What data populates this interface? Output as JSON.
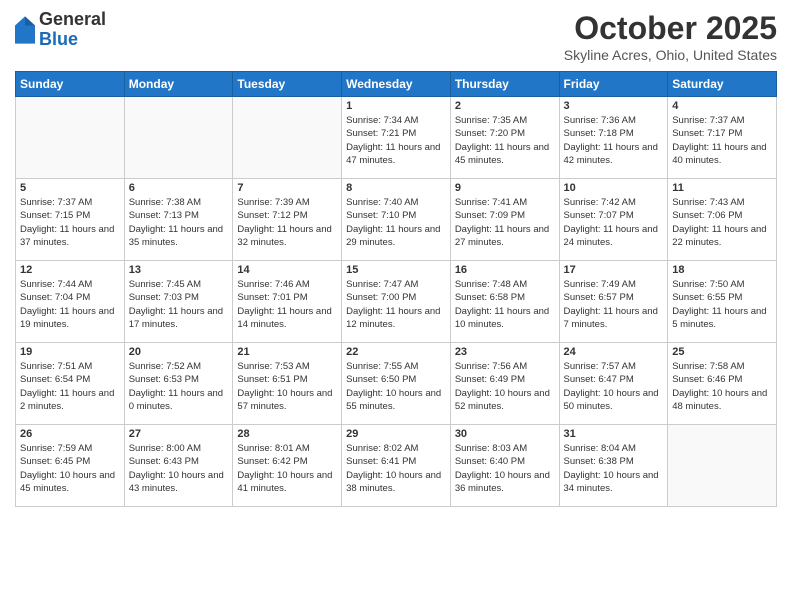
{
  "header": {
    "logo_general": "General",
    "logo_blue": "Blue",
    "title": "October 2025",
    "subtitle": "Skyline Acres, Ohio, United States"
  },
  "days_of_week": [
    "Sunday",
    "Monday",
    "Tuesday",
    "Wednesday",
    "Thursday",
    "Friday",
    "Saturday"
  ],
  "weeks": [
    [
      {
        "day": "",
        "info": ""
      },
      {
        "day": "",
        "info": ""
      },
      {
        "day": "",
        "info": ""
      },
      {
        "day": "1",
        "info": "Sunrise: 7:34 AM\nSunset: 7:21 PM\nDaylight: 11 hours\nand 47 minutes."
      },
      {
        "day": "2",
        "info": "Sunrise: 7:35 AM\nSunset: 7:20 PM\nDaylight: 11 hours\nand 45 minutes."
      },
      {
        "day": "3",
        "info": "Sunrise: 7:36 AM\nSunset: 7:18 PM\nDaylight: 11 hours\nand 42 minutes."
      },
      {
        "day": "4",
        "info": "Sunrise: 7:37 AM\nSunset: 7:17 PM\nDaylight: 11 hours\nand 40 minutes."
      }
    ],
    [
      {
        "day": "5",
        "info": "Sunrise: 7:37 AM\nSunset: 7:15 PM\nDaylight: 11 hours\nand 37 minutes."
      },
      {
        "day": "6",
        "info": "Sunrise: 7:38 AM\nSunset: 7:13 PM\nDaylight: 11 hours\nand 35 minutes."
      },
      {
        "day": "7",
        "info": "Sunrise: 7:39 AM\nSunset: 7:12 PM\nDaylight: 11 hours\nand 32 minutes."
      },
      {
        "day": "8",
        "info": "Sunrise: 7:40 AM\nSunset: 7:10 PM\nDaylight: 11 hours\nand 29 minutes."
      },
      {
        "day": "9",
        "info": "Sunrise: 7:41 AM\nSunset: 7:09 PM\nDaylight: 11 hours\nand 27 minutes."
      },
      {
        "day": "10",
        "info": "Sunrise: 7:42 AM\nSunset: 7:07 PM\nDaylight: 11 hours\nand 24 minutes."
      },
      {
        "day": "11",
        "info": "Sunrise: 7:43 AM\nSunset: 7:06 PM\nDaylight: 11 hours\nand 22 minutes."
      }
    ],
    [
      {
        "day": "12",
        "info": "Sunrise: 7:44 AM\nSunset: 7:04 PM\nDaylight: 11 hours\nand 19 minutes."
      },
      {
        "day": "13",
        "info": "Sunrise: 7:45 AM\nSunset: 7:03 PM\nDaylight: 11 hours\nand 17 minutes."
      },
      {
        "day": "14",
        "info": "Sunrise: 7:46 AM\nSunset: 7:01 PM\nDaylight: 11 hours\nand 14 minutes."
      },
      {
        "day": "15",
        "info": "Sunrise: 7:47 AM\nSunset: 7:00 PM\nDaylight: 11 hours\nand 12 minutes."
      },
      {
        "day": "16",
        "info": "Sunrise: 7:48 AM\nSunset: 6:58 PM\nDaylight: 11 hours\nand 10 minutes."
      },
      {
        "day": "17",
        "info": "Sunrise: 7:49 AM\nSunset: 6:57 PM\nDaylight: 11 hours\nand 7 minutes."
      },
      {
        "day": "18",
        "info": "Sunrise: 7:50 AM\nSunset: 6:55 PM\nDaylight: 11 hours\nand 5 minutes."
      }
    ],
    [
      {
        "day": "19",
        "info": "Sunrise: 7:51 AM\nSunset: 6:54 PM\nDaylight: 11 hours\nand 2 minutes."
      },
      {
        "day": "20",
        "info": "Sunrise: 7:52 AM\nSunset: 6:53 PM\nDaylight: 11 hours\nand 0 minutes."
      },
      {
        "day": "21",
        "info": "Sunrise: 7:53 AM\nSunset: 6:51 PM\nDaylight: 10 hours\nand 57 minutes."
      },
      {
        "day": "22",
        "info": "Sunrise: 7:55 AM\nSunset: 6:50 PM\nDaylight: 10 hours\nand 55 minutes."
      },
      {
        "day": "23",
        "info": "Sunrise: 7:56 AM\nSunset: 6:49 PM\nDaylight: 10 hours\nand 52 minutes."
      },
      {
        "day": "24",
        "info": "Sunrise: 7:57 AM\nSunset: 6:47 PM\nDaylight: 10 hours\nand 50 minutes."
      },
      {
        "day": "25",
        "info": "Sunrise: 7:58 AM\nSunset: 6:46 PM\nDaylight: 10 hours\nand 48 minutes."
      }
    ],
    [
      {
        "day": "26",
        "info": "Sunrise: 7:59 AM\nSunset: 6:45 PM\nDaylight: 10 hours\nand 45 minutes."
      },
      {
        "day": "27",
        "info": "Sunrise: 8:00 AM\nSunset: 6:43 PM\nDaylight: 10 hours\nand 43 minutes."
      },
      {
        "day": "28",
        "info": "Sunrise: 8:01 AM\nSunset: 6:42 PM\nDaylight: 10 hours\nand 41 minutes."
      },
      {
        "day": "29",
        "info": "Sunrise: 8:02 AM\nSunset: 6:41 PM\nDaylight: 10 hours\nand 38 minutes."
      },
      {
        "day": "30",
        "info": "Sunrise: 8:03 AM\nSunset: 6:40 PM\nDaylight: 10 hours\nand 36 minutes."
      },
      {
        "day": "31",
        "info": "Sunrise: 8:04 AM\nSunset: 6:38 PM\nDaylight: 10 hours\nand 34 minutes."
      },
      {
        "day": "",
        "info": ""
      }
    ]
  ]
}
